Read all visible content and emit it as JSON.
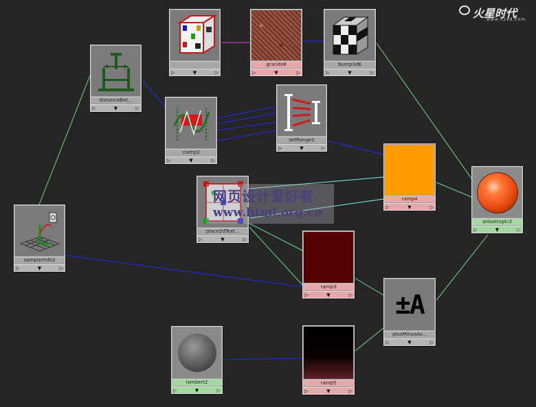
{
  "logo": {
    "brand": "火星时代",
    "url": "www.hxsd.com"
  },
  "watermark": {
    "line1": "网页设计爱好者",
    "line2": "www.html.org.cn"
  },
  "ports": {
    "left": "▷",
    "mid": "▼",
    "right": "▷"
  },
  "nodes": {
    "sampler": {
      "label": "samplerInfo2"
    },
    "distance": {
      "label": "distanceBet..."
    },
    "clamp": {
      "label": "clamp2"
    },
    "checker": {
      "label": ""
    },
    "granite": {
      "label": "granite8"
    },
    "bump": {
      "label": "bump3d6"
    },
    "setrange": {
      "label": "setRange2"
    },
    "place": {
      "label": "place2dText..."
    },
    "ramp4": {
      "label": "ramp4",
      "color": "#ff9a00"
    },
    "ramp3": {
      "label": "ramp3",
      "color": "#520000"
    },
    "ramp5": {
      "label": "ramp5"
    },
    "blend": {
      "label": "plusMinusAv...",
      "symbol": "±A"
    },
    "aniso": {
      "label": "anisotropic3"
    },
    "lambert": {
      "label": "lambert2"
    }
  },
  "wire_colors": {
    "blue": "#2a2aff",
    "green": "#6fdc8c",
    "magenta": "#e040e0",
    "cyan": "#7ff5e6"
  }
}
